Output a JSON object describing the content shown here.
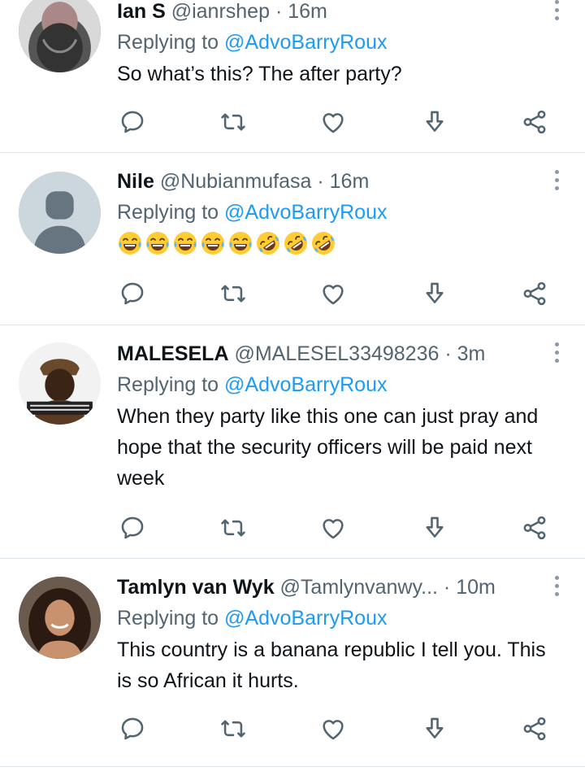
{
  "tweets": [
    {
      "name": "Ian S",
      "handle": "@ianrshep",
      "sep": "·",
      "time": "16m",
      "reply_prefix": "Replying to ",
      "reply_to": "@AdvoBarryRoux",
      "text": "So what’s this? The after party?"
    },
    {
      "name": "Nile",
      "handle": "@Nubianmufasa",
      "sep": "·",
      "time": "16m",
      "reply_prefix": "Replying to ",
      "reply_to": "@AdvoBarryRoux",
      "emojis": [
        "face-with-tears-of-joy",
        "face-with-tears-of-joy",
        "face-with-tears-of-joy",
        "face-with-tears-of-joy",
        "face-with-tears-of-joy",
        "rolling-on-floor-laughing",
        "rolling-on-floor-laughing",
        "rolling-on-floor-laughing"
      ]
    },
    {
      "name": "MALESELA",
      "handle": "@MALESEL33498236",
      "sep": "·",
      "time": "3m",
      "reply_prefix": "Replying to ",
      "reply_to": "@AdvoBarryRoux",
      "text": "When they party like this one can just pray and hope that the security officers will be paid next week"
    },
    {
      "name": "Tamlyn van Wyk",
      "handle": "@Tamlynvanwy...",
      "sep": "·",
      "time": "10m",
      "reply_prefix": "Replying to ",
      "reply_to": "@AdvoBarryRoux",
      "text": "This country is a banana republic I tell you. This is so African it hurts."
    }
  ],
  "action_icons": [
    "reply-icon",
    "retweet-icon",
    "like-icon",
    "download-icon",
    "share-icon"
  ],
  "colors": {
    "link": "#1d9bf0",
    "muted": "#536471",
    "divider": "#e1e8ed"
  }
}
